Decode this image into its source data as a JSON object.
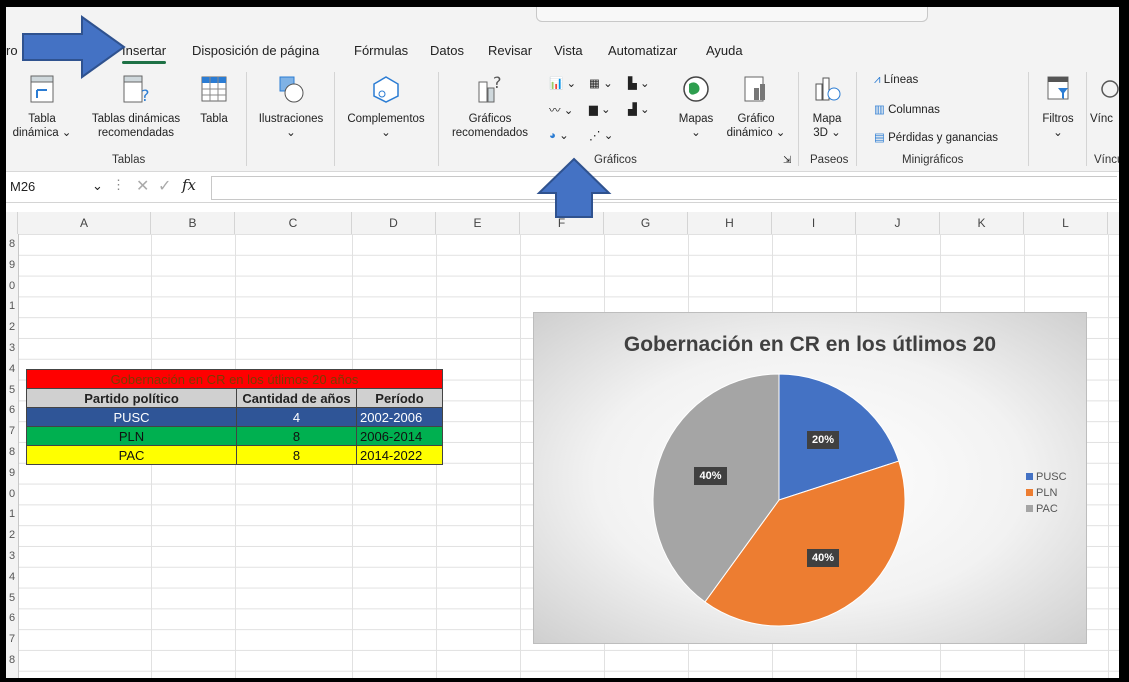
{
  "ribbon_tabs": {
    "file_partial": "ro",
    "insert": "Insertar",
    "layout": "Disposición de página",
    "formulas": "Fórmulas",
    "data": "Datos",
    "review": "Revisar",
    "view": "Vista",
    "automate": "Automatizar",
    "help": "Ayuda"
  },
  "ribbon": {
    "pivot_table": [
      "Tabla",
      "dinámica ⌄"
    ],
    "rec_pivot": [
      "Tablas dinámicas",
      "recomendadas"
    ],
    "table": "Tabla",
    "group_tables": "Tablas",
    "illustrations": "Ilustraciones",
    "addins": "Complementos",
    "rec_charts": [
      "Gráficos",
      "recomendados"
    ],
    "maps": "Mapas",
    "pivot_chart": [
      "Gráfico",
      "dinámico ⌄"
    ],
    "group_charts": "Gráficos",
    "map3d": [
      "Mapa",
      "3D ⌄"
    ],
    "group_tours": "Paseos",
    "spark_lines": "Líneas",
    "spark_columns": "Columnas",
    "spark_winloss": "Pérdidas y ganancias",
    "group_sparklines": "Minigráficos",
    "filters": "Filtros",
    "links_partial": "Vínc",
    "links_group_partial": "Víncu"
  },
  "formula_bar": {
    "name_box": "M26",
    "fx": "fx"
  },
  "columns": [
    "A",
    "B",
    "C",
    "D",
    "E",
    "F",
    "G",
    "H",
    "I",
    "J",
    "K",
    "L"
  ],
  "row_numbers": [
    "8",
    "9",
    "0",
    "1",
    "2",
    "3",
    "4",
    "5",
    "6",
    "7",
    "8",
    "9",
    "0",
    "1",
    "2",
    "3",
    "4",
    "5",
    "6",
    "7",
    "8"
  ],
  "table": {
    "title": "Gobernación en CR en los útlimos 20 años",
    "headers": [
      "Partido político",
      "Cantidad de años",
      "Período"
    ],
    "rows": [
      {
        "party": "PUSC",
        "years": "4",
        "period": "2002-2006"
      },
      {
        "party": "PLN",
        "years": "8",
        "period": "2006-2014"
      },
      {
        "party": "PAC",
        "years": "8",
        "period": "2014-2022"
      }
    ]
  },
  "chart_data": {
    "type": "pie",
    "title": "Gobernación en CR en los útlimos 20",
    "categories": [
      "PUSC",
      "PLN",
      "PAC"
    ],
    "values": [
      4,
      8,
      8
    ],
    "labels": [
      "20%",
      "40%",
      "40%"
    ],
    "colors": [
      "#4472c4",
      "#ed7d31",
      "#a5a5a5"
    ],
    "legend": "right"
  }
}
